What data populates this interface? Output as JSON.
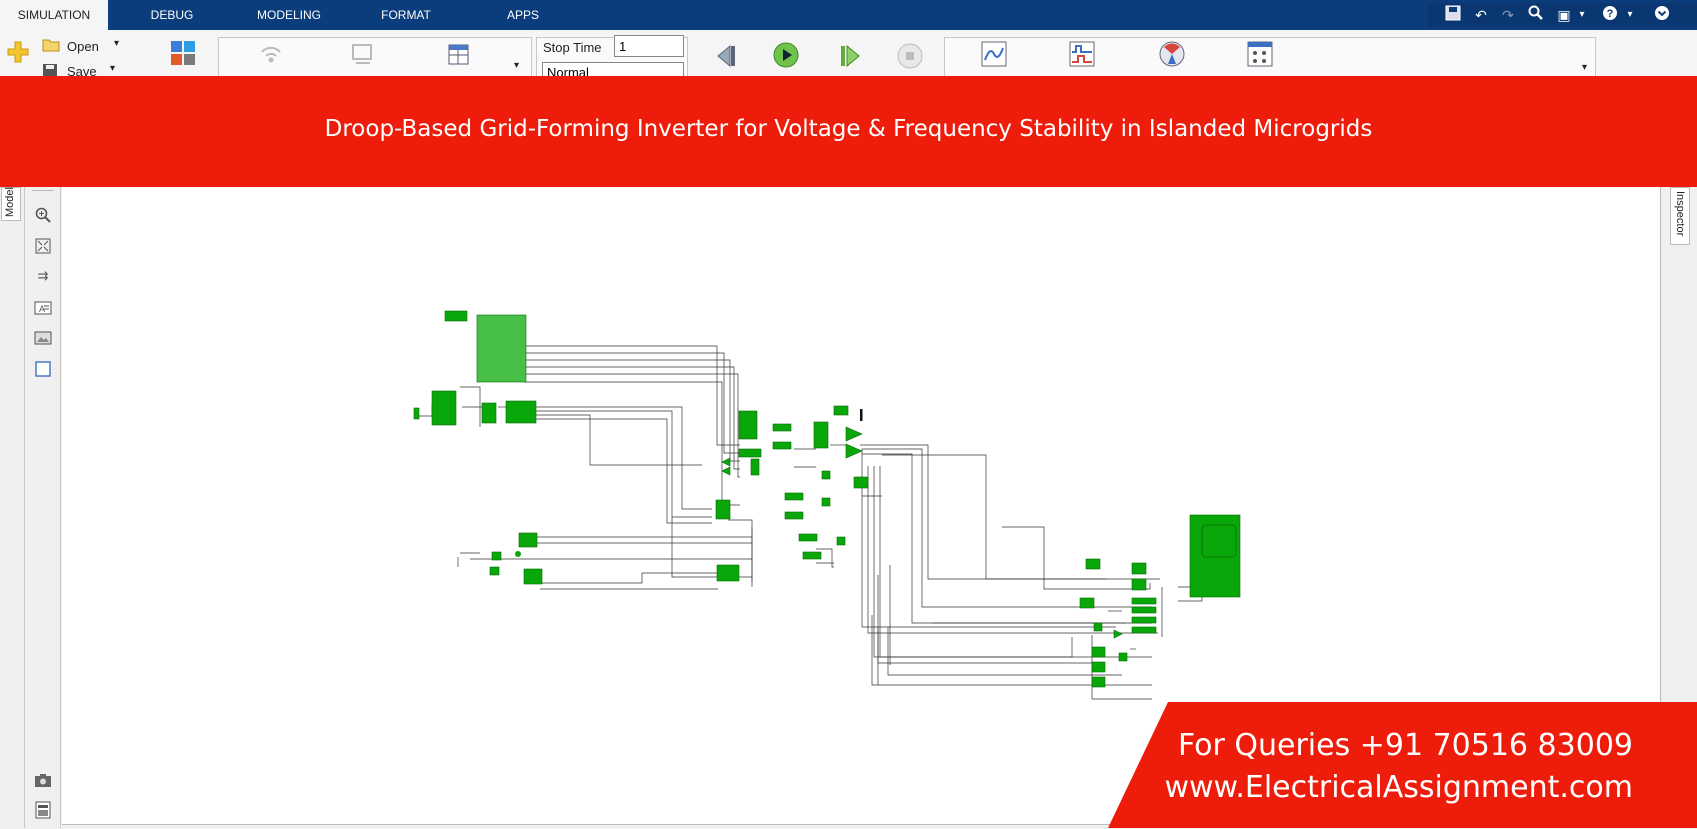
{
  "tabs": [
    "SIMULATION",
    "DEBUG",
    "MODELING",
    "FORMAT",
    "APPS"
  ],
  "toolstrip": {
    "open_label": "Open",
    "save_label": "Save",
    "stop_time_label": "Stop Time",
    "stop_time_value": "1",
    "mode_value": "Normal"
  },
  "banner": {
    "title": "Droop-Based Grid-Forming Inverter for Voltage & Frequency Stability in Islanded Microgrids"
  },
  "side_tabs": {
    "left": "Model",
    "right": "Inspector"
  },
  "footer": {
    "queries": "For Queries +91 70516 83009",
    "website": "www.ElectricalAssignment.com"
  },
  "colors": {
    "tabbar": "#0b3d7c",
    "banner": "#ee1d0b",
    "block_green": "#11aa11"
  },
  "icons": {
    "quick_access": [
      "save-icon",
      "undo-icon",
      "redo-icon",
      "search-icon",
      "window-icon",
      "help-icon",
      "collapse-icon"
    ],
    "palette": [
      "zoom-in-icon",
      "fit-view-icon",
      "arrows-icon",
      "annotation-icon",
      "image-icon",
      "area-icon",
      "camera-icon",
      "preferences-icon"
    ]
  }
}
